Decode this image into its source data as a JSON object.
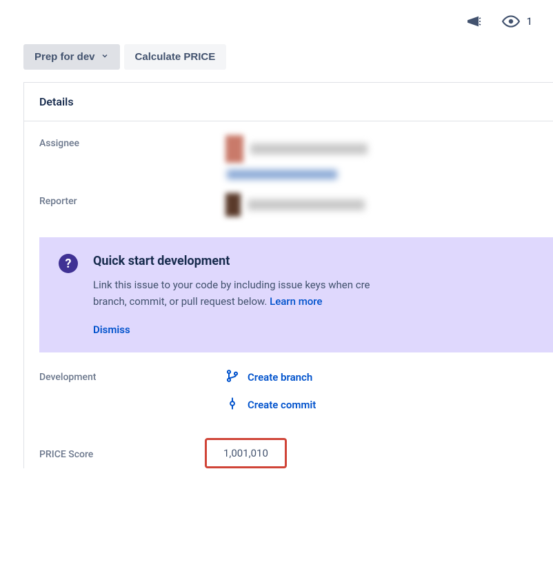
{
  "topbar": {
    "watch_count": "1"
  },
  "actions": {
    "prep_label": "Prep for dev",
    "calc_label": "Calculate PRICE"
  },
  "panel": {
    "title": "Details"
  },
  "fields": {
    "assignee_label": "Assignee",
    "reporter_label": "Reporter",
    "development_label": "Development",
    "price_score_label": "PRICE Score",
    "price_score_value": "1,001,010"
  },
  "dev_links": {
    "create_branch": "Create branch",
    "create_commit": "Create commit"
  },
  "info": {
    "title": "Quick start development",
    "text_part1": "Link this issue to your code by including issue keys when cre",
    "text_part2": "branch, commit, or pull request below. ",
    "learn_more": "Learn more",
    "dismiss": "Dismiss"
  }
}
